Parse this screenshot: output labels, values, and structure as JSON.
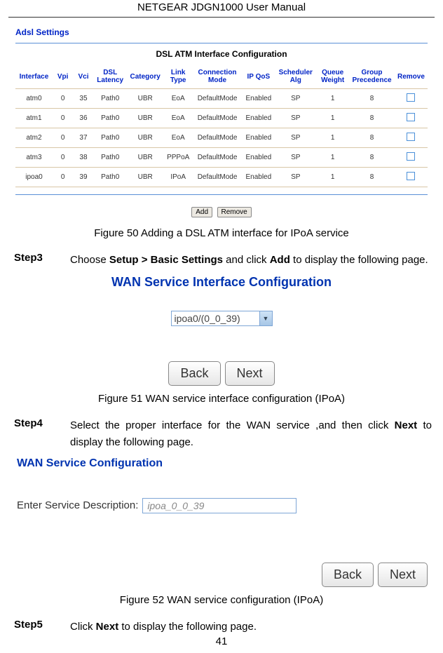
{
  "header": "NETGEAR JDGN1000 User Manual",
  "adsl_heading": "Adsl Settings",
  "atm_title": "DSL ATM Interface Configuration",
  "atm_cols": [
    "Interface",
    "Vpi",
    "Vci",
    "DSL Latency",
    "Category",
    "Link Type",
    "Connection Mode",
    "IP QoS",
    "Scheduler Alg",
    "Queue Weight",
    "Group Precedence",
    "Remove"
  ],
  "atm_rows": [
    [
      "atm0",
      "0",
      "35",
      "Path0",
      "UBR",
      "EoA",
      "DefaultMode",
      "Enabled",
      "SP",
      "1",
      "8"
    ],
    [
      "atm1",
      "0",
      "36",
      "Path0",
      "UBR",
      "EoA",
      "DefaultMode",
      "Enabled",
      "SP",
      "1",
      "8"
    ],
    [
      "atm2",
      "0",
      "37",
      "Path0",
      "UBR",
      "EoA",
      "DefaultMode",
      "Enabled",
      "SP",
      "1",
      "8"
    ],
    [
      "atm3",
      "0",
      "38",
      "Path0",
      "UBR",
      "PPPoA",
      "DefaultMode",
      "Enabled",
      "SP",
      "1",
      "8"
    ],
    [
      "ipoa0",
      "0",
      "39",
      "Path0",
      "UBR",
      "IPoA",
      "DefaultMode",
      "Enabled",
      "SP",
      "1",
      "8"
    ]
  ],
  "add_label": "Add",
  "remove_label": "Remove",
  "fig50": "Figure 50 Adding a DSL ATM interface for IPoA service",
  "step3_label": "Step3",
  "step3_prefix": "Choose ",
  "step3_b1": "Setup > Basic Settings",
  "step3_mid": " and click ",
  "step3_b2": "Add",
  "step3_suffix": " to display the following page.",
  "wan_if_title": "WAN Service Interface Configuration",
  "interface_value": "ipoa0/(0_0_39)",
  "back_label": "Back",
  "next_label": "Next",
  "fig51": "Figure 51 WAN service interface configuration (IPoA)",
  "step4_label": "Step4",
  "step4_prefix": "Select the proper interface for the WAN service ,and then click ",
  "step4_b1": "Next",
  "step4_suffix": " to display the following page.",
  "wan_config_title": "WAN Service Configuration",
  "svc_desc_label": "Enter Service Description:",
  "svc_desc_value": "ipoa_0_0_39",
  "fig52": "Figure 52 WAN service configuration (IPoA)",
  "step5_label": "Step5",
  "step5_prefix": "Click ",
  "step5_b1": "Next",
  "step5_suffix": " to display the following page.",
  "page_number": "41"
}
